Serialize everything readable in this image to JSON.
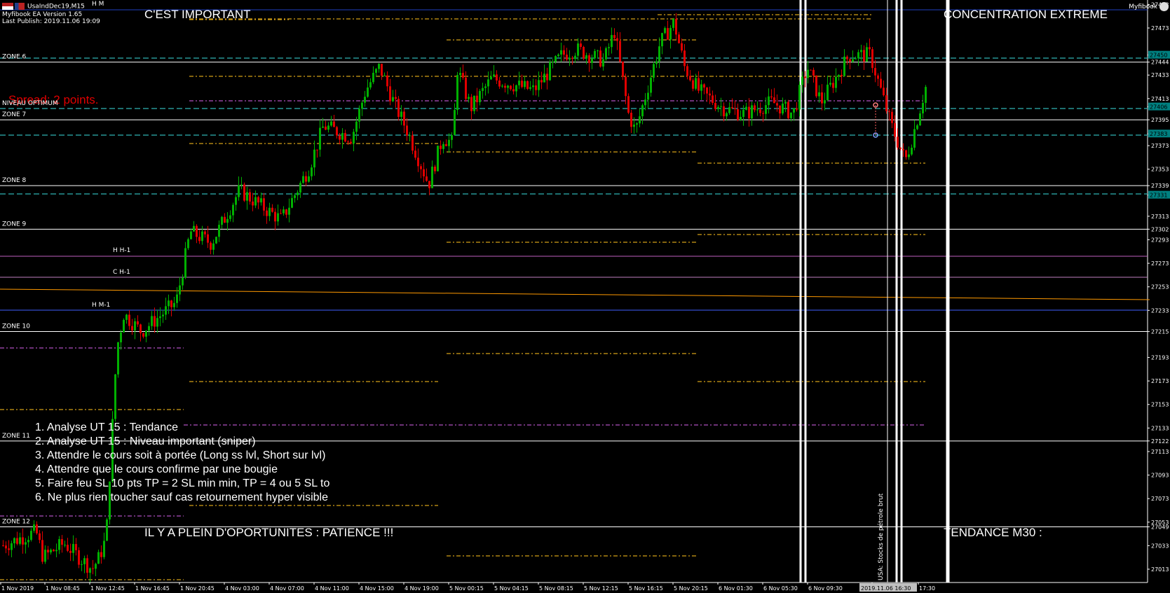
{
  "window": {
    "symbol_title": "UsaIndDec19,M15",
    "ea_version": "Myfibook EA Version 1.65",
    "last_publish": "Last Publish: 2019.11.06 19:09",
    "brand": "Myfibook"
  },
  "labels": {
    "hm": "H M",
    "important": "C'EST IMPORTANT",
    "concentration": "CONCENTRATION EXTREME",
    "spread": "Spread: 2 points.",
    "niveau": "NIVEAU OPTIMUM",
    "hh1": "H H-1",
    "ch1": "C H-1",
    "hm1": "H M-1",
    "opportunites": "IL Y A PLEIN D'OPORTUNITES : PATIENCE !!!",
    "tendance": "TENDANCE M30 :",
    "event": "USA: Stocks de pétrole brut"
  },
  "zones": [
    {
      "name": "ZONE 6",
      "price": 27444
    },
    {
      "name": "ZONE 7",
      "price": 27395
    },
    {
      "name": "ZONE 8",
      "price": 27339
    },
    {
      "name": "ZONE 9",
      "price": 27302
    },
    {
      "name": "ZONE 10",
      "price": 27215
    },
    {
      "name": "ZONE 11",
      "price": 27122
    },
    {
      "name": "ZONE 12",
      "price": 27049
    }
  ],
  "checklist": [
    "1. Analyse UT 15 : Tendance",
    "2. Analyse UT 15 : Niveau important (sniper)",
    "3. Attendre le cours soit à portée (Long ss lvl, Short sur lvl)",
    "4. Attendre que le cours confirme par une bougie",
    "5. Faire feu SL 10 pts TP = 2 SL min min, TP = 4 ou 5 SL to",
    "6. Ne plus rien toucher sauf cas retournement hyper visible"
  ],
  "price_axis": [
    "27493",
    "27473",
    "27450",
    "27444",
    "27433",
    "27413",
    "27406",
    "27395",
    "27383",
    "27373",
    "27353",
    "27339",
    "27331",
    "27313",
    "27302",
    "27293",
    "27273",
    "27253",
    "27233",
    "27215",
    "27193",
    "27173",
    "27153",
    "27133",
    "27122",
    "27113",
    "27093",
    "27073",
    "27053",
    "27049",
    "27033",
    "27013"
  ],
  "price_badges": [
    {
      "price": "27450",
      "color": "#008080"
    },
    {
      "price": "27406",
      "color": "#008080"
    },
    {
      "price": "27383",
      "color": "#008080"
    },
    {
      "price": "27331",
      "color": "#008080"
    }
  ],
  "time_axis": [
    "1 Nov 2019",
    "1 Nov 08:45",
    "1 Nov 12:45",
    "1 Nov 16:45",
    "1 Nov 20:45",
    "4 Nov 03:00",
    "4 Nov 07:00",
    "4 Nov 11:00",
    "4 Nov 15:00",
    "4 Nov 19:00",
    "5 Nov 00:15",
    "5 Nov 04:15",
    "5 Nov 08:15",
    "5 Nov 12:15",
    "5 Nov 16:15",
    "5 Nov 20:15",
    "6 Nov 01:30",
    "6 Nov 05:30",
    "6 Nov 09:30",
    "6",
    "2019.11.06 16:30",
    "17:30"
  ],
  "colors": {
    "bull": "#00b000",
    "bear": "#e00000",
    "zone_line": "#ffffff",
    "cyan_line": "#2fb3b3",
    "gold_dash": "#d4a017",
    "violet_dash": "#b050c0",
    "blue_line": "#4060ff",
    "orange_line": "#ff9900"
  }
}
